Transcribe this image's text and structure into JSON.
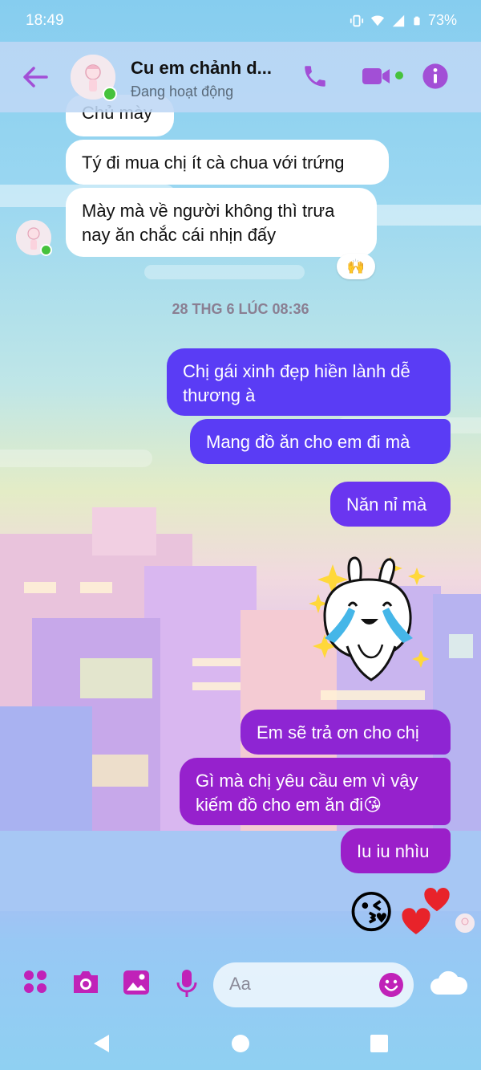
{
  "status": {
    "time": "18:49",
    "battery": "73%"
  },
  "header": {
    "title": "Cu em chảnh d...",
    "subtitle": "Đang hoạt động"
  },
  "messages": {
    "in_0": "Chủ mày",
    "in_1": "Tý đi mua chị ít cà chua với trứng",
    "in_2": "Mày mà về người không thì trưa nay ăn chắc cái nhịn đấy",
    "reaction": "🙌",
    "timestamp": "28 THG 6 LÚC 08:36",
    "out_0": "Chị gái xinh đẹp hiền lành dễ thương à",
    "out_1": "Mang đồ ăn cho em đi mà",
    "out_2": "Năn nỉ mà",
    "out_3": "Em sẽ trả ơn cho chị",
    "out_4": "Gì mà chị yêu cầu em vì vậy kiếm đồ cho em ăn đi😘",
    "out_5": "Iu iu nhìu",
    "emoji": "😘"
  },
  "composer": {
    "placeholder": "Aa"
  },
  "colors": {
    "accent": "#a24fd6",
    "out_top": "#5a3cf5",
    "out_bottom": "#9b1fc9",
    "composer_icon": "#c022b8"
  }
}
